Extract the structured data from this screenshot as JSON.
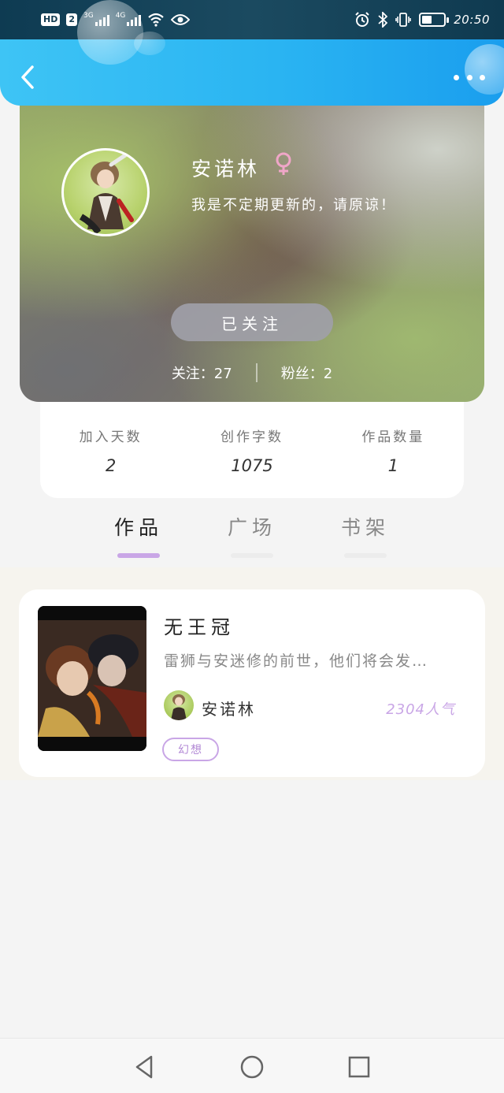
{
  "status_bar": {
    "hd_label": "HD",
    "sim_label": "2",
    "net1_label": "3G",
    "net2_label": "4G",
    "battery_level": 0.45,
    "time": "20:50",
    "icons": [
      "signal-icon",
      "wifi-icon",
      "eye-icon",
      "alarm-icon",
      "bluetooth-icon",
      "vibrate-icon",
      "battery-icon"
    ]
  },
  "header": {
    "back_icon": "chevron-left-icon",
    "more_icon": "more-dots-icon"
  },
  "profile": {
    "name": "安诺林",
    "gender_symbol": "♀",
    "bio": "我是不定期更新的，请原谅！",
    "follow_button_label": "已关注",
    "following_text": "关注：27",
    "fans_text": "粉丝：2"
  },
  "stats": [
    {
      "label": "加入天数",
      "value": "2"
    },
    {
      "label": "创作字数",
      "value": "1075"
    },
    {
      "label": "作品数量",
      "value": "1"
    }
  ],
  "tabs": [
    {
      "label": "作品",
      "active": true
    },
    {
      "label": "广场",
      "active": false
    },
    {
      "label": "书架",
      "active": false
    }
  ],
  "works": [
    {
      "title": "无王冠",
      "description": "雷狮与安迷修的前世，他们将会发…",
      "author": "安诺林",
      "popularity": "2304人气",
      "genre": "幻想"
    }
  ],
  "colors": {
    "accent_purple": "#c9a6e6",
    "header_blue": "#2ab4f2",
    "status_bar": "#123b50"
  }
}
